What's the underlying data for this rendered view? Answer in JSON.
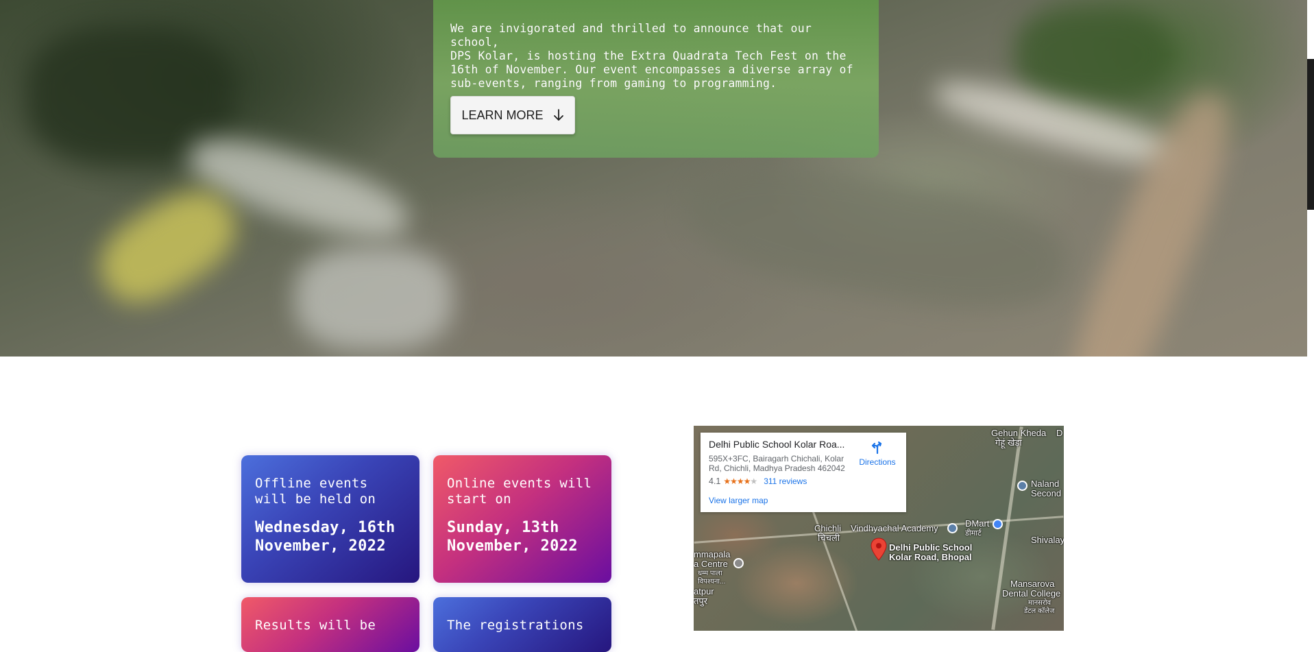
{
  "hero": {
    "announcement": "We are invigorated and thrilled to announce that our school,\nDPS Kolar, is hosting the Extra Quadrata Tech Fest on the\n16th of November. Our event encompasses a diverse array of\nsub-events, ranging from gaming to programming.",
    "learn_more_label": "LEARN MORE",
    "learn_more_icon": "arrow-down-icon"
  },
  "cards": [
    {
      "label": "Offline events will be held on",
      "date": "Wednesday, 16th November, 2022",
      "color": "blue"
    },
    {
      "label": "Online events will start on",
      "date": "Sunday, 13th November, 2022",
      "color": "pink"
    },
    {
      "label": "Results will be",
      "date": "",
      "color": "pink"
    },
    {
      "label": "The registrations",
      "date": "",
      "color": "blue"
    }
  ],
  "map": {
    "place_title": "Delhi Public School Kolar Roa...",
    "address": "595X+3FC, Bairagarh Chichali, Kolar Rd, Chichli, Madhya Pradesh 462042",
    "rating": "4.1",
    "stars_filled": 4,
    "stars_total": 5,
    "reviews": "311 reviews",
    "directions_label": "Directions",
    "larger_map_label": "View larger map",
    "labels": {
      "gehun_kheda": "Gehun Kheda",
      "gehun_kheda_hi": "गेहूं खेड़ा",
      "nalanda": "Naland",
      "second": "Second",
      "dmart": "DMart",
      "dmart_hi": "डीमार्ट",
      "vindhyachal": "Vindhyachal Academy",
      "chichli": "Chichli",
      "chichli_hi": "चिचली",
      "shivalay": "Shivalay",
      "dps_line1": "Delhi Public School",
      "dps_line2": "Kolar Road, Bhopal",
      "mmapala": "mmapala",
      "a_centre": "a Centre",
      "hi_1": "धम्म पाला",
      "hi_2": "विपश्यना...",
      "atpur": "atpur",
      "atpur_hi": "तपुर",
      "mansarovar": "Mansarova",
      "dental": "Dental College",
      "mansarovar_hi": "मानसरोव",
      "dental_hi": "डेंटल कॉलेज",
      "edge_d": "D"
    },
    "colors": {
      "pin": "#ea4335",
      "directions": "#1a73e8",
      "stars": "#e7711b"
    }
  }
}
